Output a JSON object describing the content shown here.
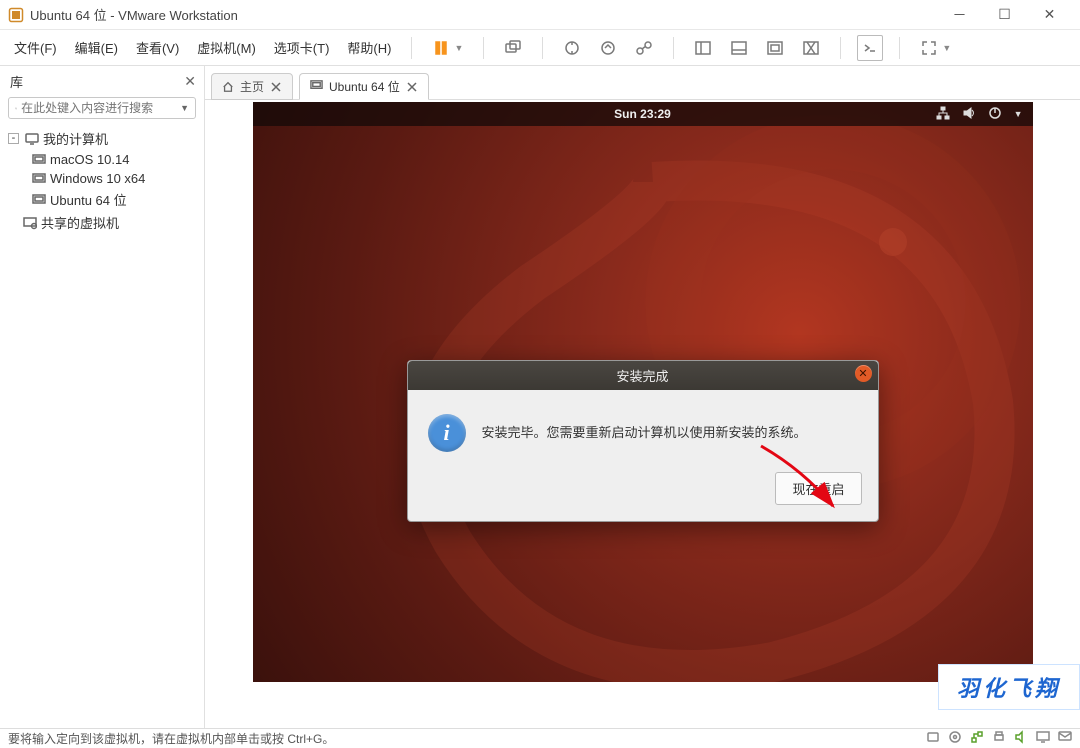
{
  "window": {
    "title": "Ubuntu 64 位 - VMware Workstation"
  },
  "menu": {
    "file": "文件(F)",
    "edit": "编辑(E)",
    "view": "查看(V)",
    "vm": "虚拟机(M)",
    "tabs": "选项卡(T)",
    "help": "帮助(H)"
  },
  "sidebar": {
    "title": "库",
    "search_placeholder": "在此处键入内容进行搜索",
    "root": "我的计算机",
    "items": [
      "macOS 10.14",
      "Windows 10 x64",
      "Ubuntu 64 位"
    ],
    "shared": "共享的虚拟机"
  },
  "tabs": {
    "home": "主页",
    "vm": "Ubuntu 64 位"
  },
  "ubuntu": {
    "clock": "Sun 23:29"
  },
  "dialog": {
    "title": "安装完成",
    "body": "安装完毕。您需要重新启动计算机以使用新安装的系统。",
    "button": "现在重启"
  },
  "watermark": {
    "center": "羽化飞翔",
    "corner": "羽化飞翔"
  },
  "statusbar": {
    "text": "要将输入定向到该虚拟机，请在虚拟机内部单击或按 Ctrl+G。"
  }
}
